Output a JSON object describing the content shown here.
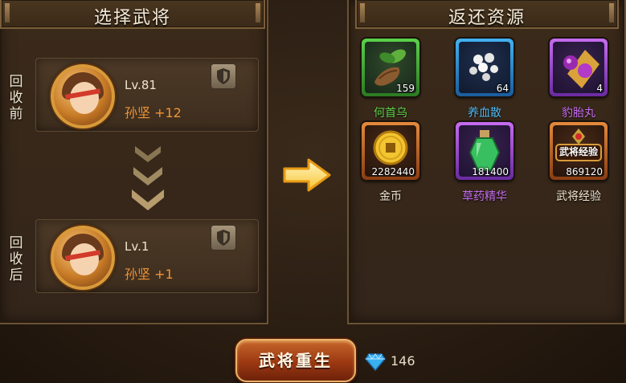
{
  "left_panel": {
    "title": "选择武将",
    "before": {
      "label_chars": [
        "回",
        "收",
        "前"
      ],
      "level": "Lv.81",
      "hero": "孙坚 +12"
    },
    "after": {
      "label_chars": [
        "回",
        "收",
        "后"
      ],
      "level": "Lv.1",
      "hero": "孙坚 +1"
    }
  },
  "right_panel": {
    "title": "返还资源",
    "items": [
      {
        "name": "何首乌",
        "qty": "159",
        "rarity": "green",
        "name_color": "#5ed24a"
      },
      {
        "name": "养血散",
        "qty": "64",
        "rarity": "blue",
        "name_color": "#4fb8f0"
      },
      {
        "name": "豹胎丸",
        "qty": "4",
        "rarity": "purple",
        "name_color": "#c86df0"
      },
      {
        "name": "金币",
        "qty": "2282440",
        "rarity": "orange",
        "name_color": "#f0e4cf"
      },
      {
        "name": "草药精华",
        "qty": "181400",
        "rarity": "purple",
        "name_color": "#c86df0"
      },
      {
        "name": "武将经验",
        "qty": "869120",
        "rarity": "orange",
        "name_color": "#f0e4cf",
        "icon_text": "武将经验"
      }
    ]
  },
  "footer": {
    "rebirth_label": "武将重生",
    "gem_count": "146"
  }
}
